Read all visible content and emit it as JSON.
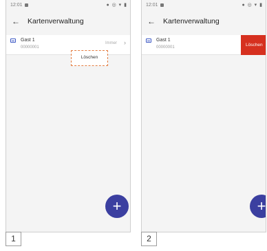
{
  "screens": [
    {
      "status_time": "12:01",
      "status_icons": "● ◎ ▾ ▮",
      "back_glyph": "←",
      "title": "Kartenverwaltung",
      "card": {
        "name": "Gast 1",
        "number": "00000001",
        "validity": "Immer",
        "chevron": "›"
      },
      "context_menu_item": "Löschen",
      "fab_glyph": "+",
      "step": "1"
    },
    {
      "status_time": "12:01",
      "status_icons": "● ◎ ▾ ▮",
      "back_glyph": "←",
      "title": "Kartenverwaltung",
      "card": {
        "name": "Gast 1",
        "number": "00000001"
      },
      "delete_label": "Löschen",
      "fab_glyph": "+",
      "step": "2"
    }
  ],
  "colors": {
    "accent": "#3b3fa0",
    "delete": "#d6301f",
    "highlight": "#e37b3f",
    "card_icon": "#3a56c4"
  },
  "icons": {
    "back": "arrow-left-icon",
    "card": "card-icon",
    "chevron": "chevron-right-icon",
    "fab": "plus-icon"
  }
}
